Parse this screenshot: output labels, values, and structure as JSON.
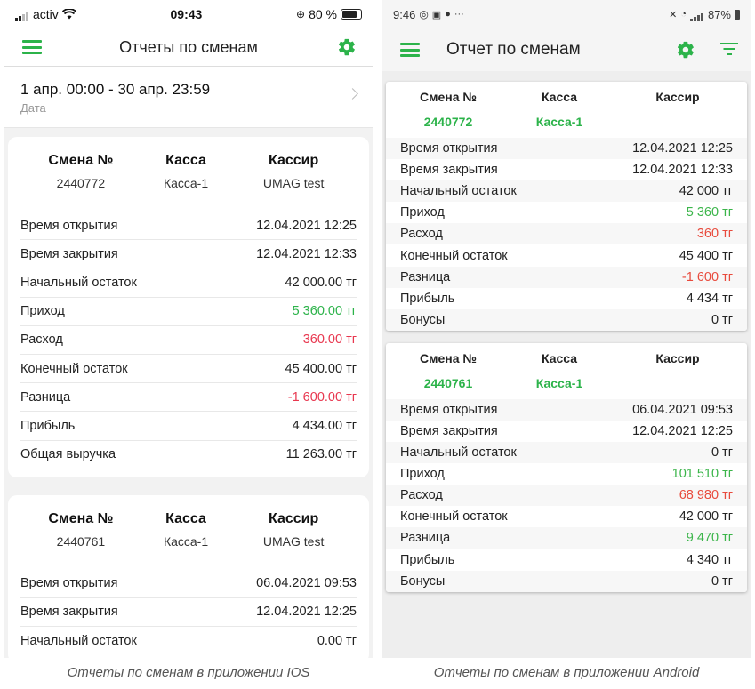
{
  "ios": {
    "status": {
      "carrier": "activ",
      "time": "09:43",
      "battery": "80 %"
    },
    "nav_title": "Отчеты по сменам",
    "date": {
      "value": "1 апр. 00:00 - 30 апр. 23:59",
      "label": "Дата"
    },
    "cards": [
      {
        "head": {
          "shift_label": "Смена №",
          "shift": "2440772",
          "kassa_label": "Касса",
          "kassa": "Касса-1",
          "cashier_label": "Кассир",
          "cashier": "UMAG test"
        },
        "rows": [
          {
            "label": "Время открытия",
            "value": "12.04.2021 12:25"
          },
          {
            "label": "Время закрытия",
            "value": "12.04.2021 12:33"
          },
          {
            "label": "Начальный остаток",
            "value": "42 000.00 тг"
          },
          {
            "label": "Приход",
            "value": "5 360.00 тг"
          },
          {
            "label": "Расход",
            "value": "360.00 тг"
          },
          {
            "label": "Конечный остаток",
            "value": "45 400.00 тг"
          },
          {
            "label": "Разница",
            "value": "-1 600.00 тг"
          },
          {
            "label": "Прибыль",
            "value": "4 434.00 тг"
          },
          {
            "label": "Общая выручка",
            "value": "11 263.00 тг"
          }
        ]
      },
      {
        "head": {
          "shift_label": "Смена №",
          "shift": "2440761",
          "kassa_label": "Касса",
          "kassa": "Касса-1",
          "cashier_label": "Кассир",
          "cashier": "UMAG test"
        },
        "rows": [
          {
            "label": "Время открытия",
            "value": "06.04.2021 09:53"
          },
          {
            "label": "Время закрытия",
            "value": "12.04.2021 12:25"
          },
          {
            "label": "Начальный остаток",
            "value": "0.00 тг"
          }
        ]
      }
    ],
    "caption": "Отчеты по сменам в приложении IOS"
  },
  "android": {
    "status": {
      "time": "9:46",
      "battery": "87%"
    },
    "nav_title": "Отчет по сменам",
    "cards": [
      {
        "head": {
          "shift_label": "Смена №",
          "shift": "2440772",
          "kassa_label": "Касса",
          "kassa": "Касса-1",
          "cashier_label": "Кассир"
        },
        "rows": [
          {
            "label": "Время открытия",
            "value": "12.04.2021 12:25"
          },
          {
            "label": "Время закрытия",
            "value": "12.04.2021 12:33"
          },
          {
            "label": "Начальный остаток",
            "value": "42 000 тг"
          },
          {
            "label": "Приход",
            "value": "5 360 тг"
          },
          {
            "label": "Расход",
            "value": "360 тг"
          },
          {
            "label": "Конечный остаток",
            "value": "45 400 тг"
          },
          {
            "label": "Разница",
            "value": "-1 600 тг"
          },
          {
            "label": "Прибыль",
            "value": "4 434 тг"
          },
          {
            "label": "Бонусы",
            "value": "0 тг"
          }
        ]
      },
      {
        "head": {
          "shift_label": "Смена №",
          "shift": "2440761",
          "kassa_label": "Касса",
          "kassa": "Касса-1",
          "cashier_label": "Кассир"
        },
        "rows": [
          {
            "label": "Время открытия",
            "value": "06.04.2021 09:53"
          },
          {
            "label": "Время закрытия",
            "value": "12.04.2021 12:25"
          },
          {
            "label": "Начальный остаток",
            "value": "0 тг"
          },
          {
            "label": "Приход",
            "value": "101 510 тг"
          },
          {
            "label": "Расход",
            "value": "68 980 тг"
          },
          {
            "label": "Конечный остаток",
            "value": "42 000 тг"
          },
          {
            "label": "Разница",
            "value": "9 470 тг"
          },
          {
            "label": "Прибыль",
            "value": "4 340 тг"
          },
          {
            "label": "Бонусы",
            "value": "0 тг"
          }
        ]
      }
    ],
    "caption": "Отчеты по сменам в приложении Android"
  },
  "colors": {
    "accent": "#2cb34a",
    "negative": "#e8374f",
    "positive": "#2cb34a"
  }
}
